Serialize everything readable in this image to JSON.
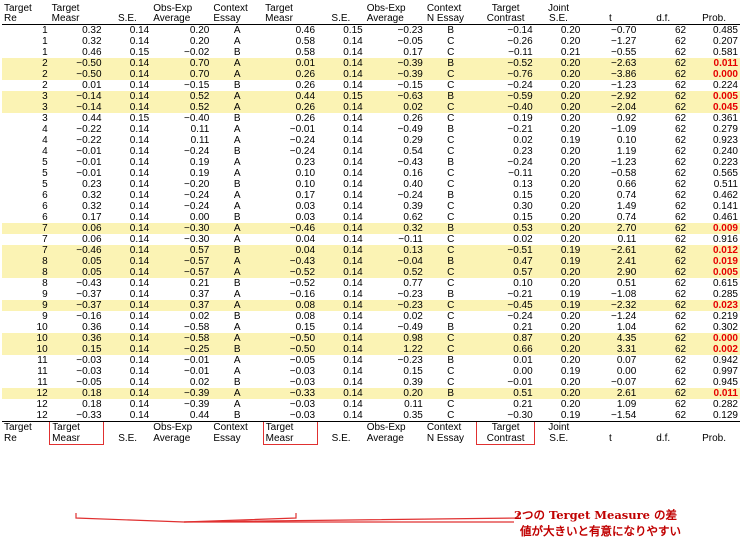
{
  "header1": [
    "Target",
    "Target",
    "",
    "Obs-Exp",
    "Context",
    "Target",
    "",
    "Obs-Exp",
    "Context",
    "Target",
    "Joint",
    "",
    "",
    ""
  ],
  "header2": [
    "Re",
    "Measr",
    "S.E.",
    "Average",
    "Essay",
    "Measr",
    "S.E.",
    "Average",
    "N Essay",
    "Contrast",
    "S.E.",
    "t",
    "d.f.",
    "Prob."
  ],
  "rows": [
    {
      "hl": false,
      "c": [
        "1",
        "0.32",
        "0.14",
        "0.20",
        "A",
        "0.46",
        "0.15",
        "−0.23",
        "B",
        "−0.14",
        "0.20",
        "−0.70",
        "62",
        "0.485"
      ]
    },
    {
      "hl": false,
      "c": [
        "1",
        "0.32",
        "0.14",
        "0.20",
        "A",
        "0.58",
        "0.14",
        "−0.05",
        "C",
        "−0.26",
        "0.20",
        "−1.27",
        "62",
        "0.207"
      ]
    },
    {
      "hl": false,
      "c": [
        "1",
        "0.46",
        "0.15",
        "−0.02",
        "B",
        "0.58",
        "0.14",
        "0.17",
        "C",
        "−0.11",
        "0.21",
        "−0.55",
        "62",
        "0.581"
      ]
    },
    {
      "hl": true,
      "c": [
        "2",
        "−0.50",
        "0.14",
        "0.70",
        "A",
        "0.01",
        "0.14",
        "−0.39",
        "B",
        "−0.52",
        "0.20",
        "−2.63",
        "62",
        "0.011"
      ],
      "sig": true
    },
    {
      "hl": true,
      "c": [
        "2",
        "−0.50",
        "0.14",
        "0.70",
        "A",
        "0.26",
        "0.14",
        "−0.39",
        "C",
        "−0.76",
        "0.20",
        "−3.86",
        "62",
        "0.000"
      ],
      "sig": true
    },
    {
      "hl": false,
      "c": [
        "2",
        "0.01",
        "0.14",
        "−0.15",
        "B",
        "0.26",
        "0.14",
        "−0.15",
        "C",
        "−0.24",
        "0.20",
        "−1.23",
        "62",
        "0.224"
      ]
    },
    {
      "hl": true,
      "c": [
        "3",
        "−0.14",
        "0.14",
        "0.52",
        "A",
        "0.44",
        "0.15",
        "−0.63",
        "B",
        "−0.59",
        "0.20",
        "−2.92",
        "62",
        "0.005"
      ],
      "sig": true
    },
    {
      "hl": true,
      "c": [
        "3",
        "−0.14",
        "0.14",
        "0.52",
        "A",
        "0.26",
        "0.14",
        "0.02",
        "C",
        "−0.40",
        "0.20",
        "−2.04",
        "62",
        "0.045"
      ],
      "sig": true
    },
    {
      "hl": false,
      "c": [
        "3",
        "0.44",
        "0.15",
        "−0.40",
        "B",
        "0.26",
        "0.14",
        "0.26",
        "C",
        "0.19",
        "0.20",
        "0.92",
        "62",
        "0.361"
      ]
    },
    {
      "hl": false,
      "c": [
        "4",
        "−0.22",
        "0.14",
        "0.11",
        "A",
        "−0.01",
        "0.14",
        "−0.49",
        "B",
        "−0.21",
        "0.20",
        "−1.09",
        "62",
        "0.279"
      ]
    },
    {
      "hl": false,
      "c": [
        "4",
        "−0.22",
        "0.14",
        "0.11",
        "A",
        "−0.24",
        "0.14",
        "0.29",
        "C",
        "0.02",
        "0.19",
        "0.10",
        "62",
        "0.923"
      ]
    },
    {
      "hl": false,
      "c": [
        "4",
        "−0.01",
        "0.14",
        "−0.24",
        "B",
        "−0.24",
        "0.14",
        "0.54",
        "C",
        "0.23",
        "0.20",
        "1.19",
        "62",
        "0.240"
      ]
    },
    {
      "hl": false,
      "c": [
        "5",
        "−0.01",
        "0.14",
        "0.19",
        "A",
        "0.23",
        "0.14",
        "−0.43",
        "B",
        "−0.24",
        "0.20",
        "−1.23",
        "62",
        "0.223"
      ]
    },
    {
      "hl": false,
      "c": [
        "5",
        "−0.01",
        "0.14",
        "0.19",
        "A",
        "0.10",
        "0.14",
        "0.16",
        "C",
        "−0.11",
        "0.20",
        "−0.58",
        "62",
        "0.565"
      ]
    },
    {
      "hl": false,
      "c": [
        "5",
        "0.23",
        "0.14",
        "−0.20",
        "B",
        "0.10",
        "0.14",
        "0.40",
        "C",
        "0.13",
        "0.20",
        "0.66",
        "62",
        "0.511"
      ]
    },
    {
      "hl": false,
      "c": [
        "6",
        "0.32",
        "0.14",
        "−0.24",
        "A",
        "0.17",
        "0.14",
        "−0.24",
        "B",
        "0.15",
        "0.20",
        "0.74",
        "62",
        "0.462"
      ]
    },
    {
      "hl": false,
      "c": [
        "6",
        "0.32",
        "0.14",
        "−0.24",
        "A",
        "0.03",
        "0.14",
        "0.39",
        "C",
        "0.30",
        "0.20",
        "1.49",
        "62",
        "0.141"
      ]
    },
    {
      "hl": false,
      "c": [
        "6",
        "0.17",
        "0.14",
        "0.00",
        "B",
        "0.03",
        "0.14",
        "0.62",
        "C",
        "0.15",
        "0.20",
        "0.74",
        "62",
        "0.461"
      ]
    },
    {
      "hl": true,
      "c": [
        "7",
        "0.06",
        "0.14",
        "−0.30",
        "A",
        "−0.46",
        "0.14",
        "0.32",
        "B",
        "0.53",
        "0.20",
        "2.70",
        "62",
        "0.009"
      ],
      "sig": true
    },
    {
      "hl": false,
      "c": [
        "7",
        "0.06",
        "0.14",
        "−0.30",
        "A",
        "0.04",
        "0.14",
        "−0.11",
        "C",
        "0.02",
        "0.20",
        "0.11",
        "62",
        "0.916"
      ]
    },
    {
      "hl": true,
      "c": [
        "7",
        "−0.46",
        "0.14",
        "0.57",
        "B",
        "0.04",
        "0.14",
        "0.13",
        "C",
        "−0.51",
        "0.19",
        "−2.61",
        "62",
        "0.012"
      ],
      "sig": true
    },
    {
      "hl": true,
      "c": [
        "8",
        "0.05",
        "0.14",
        "−0.57",
        "A",
        "−0.43",
        "0.14",
        "−0.04",
        "B",
        "0.47",
        "0.19",
        "2.41",
        "62",
        "0.019"
      ],
      "sig": true
    },
    {
      "hl": true,
      "c": [
        "8",
        "0.05",
        "0.14",
        "−0.57",
        "A",
        "−0.52",
        "0.14",
        "0.52",
        "C",
        "0.57",
        "0.20",
        "2.90",
        "62",
        "0.005"
      ],
      "sig": true
    },
    {
      "hl": false,
      "c": [
        "8",
        "−0.43",
        "0.14",
        "0.21",
        "B",
        "−0.52",
        "0.14",
        "0.77",
        "C",
        "0.10",
        "0.20",
        "0.51",
        "62",
        "0.615"
      ]
    },
    {
      "hl": false,
      "c": [
        "9",
        "−0.37",
        "0.14",
        "0.37",
        "A",
        "−0.16",
        "0.14",
        "−0.23",
        "B",
        "−0.21",
        "0.19",
        "−1.08",
        "62",
        "0.285"
      ]
    },
    {
      "hl": true,
      "c": [
        "9",
        "−0.37",
        "0.14",
        "0.37",
        "A",
        "0.08",
        "0.14",
        "−0.23",
        "C",
        "−0.45",
        "0.19",
        "−2.32",
        "62",
        "0.023"
      ],
      "sig": true
    },
    {
      "hl": false,
      "c": [
        "9",
        "−0.16",
        "0.14",
        "0.02",
        "B",
        "0.08",
        "0.14",
        "0.02",
        "C",
        "−0.24",
        "0.20",
        "−1.24",
        "62",
        "0.219"
      ]
    },
    {
      "hl": false,
      "c": [
        "10",
        "0.36",
        "0.14",
        "−0.58",
        "A",
        "0.15",
        "0.14",
        "−0.49",
        "B",
        "0.21",
        "0.20",
        "1.04",
        "62",
        "0.302"
      ]
    },
    {
      "hl": true,
      "c": [
        "10",
        "0.36",
        "0.14",
        "−0.58",
        "A",
        "−0.50",
        "0.14",
        "0.98",
        "C",
        "0.87",
        "0.20",
        "4.35",
        "62",
        "0.000"
      ],
      "sig": true
    },
    {
      "hl": true,
      "c": [
        "10",
        "0.15",
        "0.14",
        "−0.25",
        "B",
        "−0.50",
        "0.14",
        "1.22",
        "C",
        "0.66",
        "0.20",
        "3.31",
        "62",
        "0.002"
      ],
      "sig": true
    },
    {
      "hl": false,
      "c": [
        "11",
        "−0.03",
        "0.14",
        "−0.01",
        "A",
        "−0.05",
        "0.14",
        "−0.23",
        "B",
        "0.01",
        "0.20",
        "0.07",
        "62",
        "0.942"
      ]
    },
    {
      "hl": false,
      "c": [
        "11",
        "−0.03",
        "0.14",
        "−0.01",
        "A",
        "−0.03",
        "0.14",
        "0.15",
        "C",
        "0.00",
        "0.19",
        "0.00",
        "62",
        "0.997"
      ]
    },
    {
      "hl": false,
      "c": [
        "11",
        "−0.05",
        "0.14",
        "0.02",
        "B",
        "−0.03",
        "0.14",
        "0.39",
        "C",
        "−0.01",
        "0.20",
        "−0.07",
        "62",
        "0.945"
      ]
    },
    {
      "hl": true,
      "c": [
        "12",
        "0.18",
        "0.14",
        "−0.39",
        "A",
        "−0.33",
        "0.14",
        "0.20",
        "B",
        "0.51",
        "0.20",
        "2.61",
        "62",
        "0.011"
      ],
      "sig": true
    },
    {
      "hl": false,
      "c": [
        "12",
        "0.18",
        "0.14",
        "−0.39",
        "A",
        "−0.03",
        "0.14",
        "0.11",
        "C",
        "0.21",
        "0.20",
        "1.09",
        "62",
        "0.282"
      ]
    },
    {
      "hl": false,
      "c": [
        "12",
        "−0.33",
        "0.14",
        "0.44",
        "B",
        "−0.03",
        "0.14",
        "0.35",
        "C",
        "−0.30",
        "0.19",
        "−1.54",
        "62",
        "0.129"
      ]
    }
  ],
  "footer1": [
    "Target",
    "Target",
    "",
    "Obs-Exp",
    "Context",
    "Target",
    "",
    "Obs-Exp",
    "Context",
    "Target",
    "Joint",
    "",
    "",
    ""
  ],
  "footer2": [
    "Re",
    "Measr",
    "S.E.",
    "Average",
    "Essay",
    "Measr",
    "S.E.",
    "Average",
    "N Essay",
    "Contrast",
    "S.E.",
    "t",
    "d.f.",
    "Prob."
  ],
  "note": {
    "line1": "2つの Terget Measure の差",
    "line2": "値が大きいと有意になりやすい"
  },
  "colors": {
    "highlight": "#fbf3b4",
    "significant": "#e60000",
    "annotation": "#e03030"
  }
}
